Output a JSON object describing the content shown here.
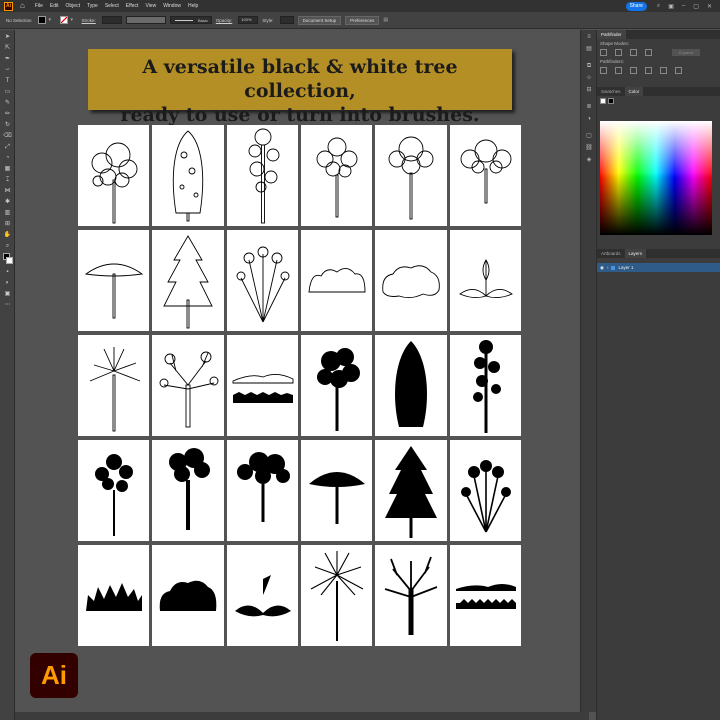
{
  "app": {
    "logo_small": "Ai",
    "logo_big": "Ai",
    "brand_color": "#ff9a00"
  },
  "menubar": {
    "home_icon": "home-icon",
    "items": [
      "File",
      "Edit",
      "Object",
      "Type",
      "Select",
      "Effect",
      "View",
      "Window",
      "Help"
    ],
    "share_label": "Share"
  },
  "control": {
    "selection": "No Selection",
    "stroke_label": "Stroke:",
    "brush": "Basic",
    "opacity_label": "Opacity:",
    "opacity_value": "100%",
    "style_label": "Style:",
    "doc_setup": "Document Setup",
    "preferences": "Preferences"
  },
  "banner": {
    "line1": "A versatile black & white tree collection,",
    "line2": "ready to use or turn into brushes.",
    "color": "#b48f25"
  },
  "panels": {
    "pathfinder_tab": "Pathfinder",
    "shape_modes": "Shape Modes:",
    "expand": "Expand",
    "pathfinders": "Pathfinders:",
    "swatches_tab": "Swatches",
    "color_tab": "Color",
    "artboards_tab": "Artboards",
    "layers_tab": "Layers",
    "layer_name": "Layer 1"
  },
  "tree_grid": {
    "rows": [
      [
        "outline-broadleaf",
        "outline-cypress",
        "outline-pine",
        "outline-oak",
        "outline-maple",
        "outline-spreading"
      ],
      [
        "outline-acacia",
        "outline-fir",
        "outline-shrub-vase",
        "outline-hedge",
        "outline-bush-cloud",
        "outline-plant-leaves"
      ],
      [
        "outline-palm",
        "outline-bare-oak",
        "silhouette-grass-hill",
        "silhouette-broadleaf",
        "silhouette-cypress",
        "silhouette-pine"
      ],
      [
        "silhouette-small-tree",
        "silhouette-round-tree",
        "silhouette-spreading",
        "silhouette-acacia",
        "silhouette-fir",
        "silhouette-plant"
      ],
      [
        "silhouette-shrub",
        "silhouette-bush",
        "silhouette-leaf-plant",
        "silhouette-palm",
        "silhouette-bare-tree",
        "silhouette-grass-strip"
      ]
    ]
  }
}
